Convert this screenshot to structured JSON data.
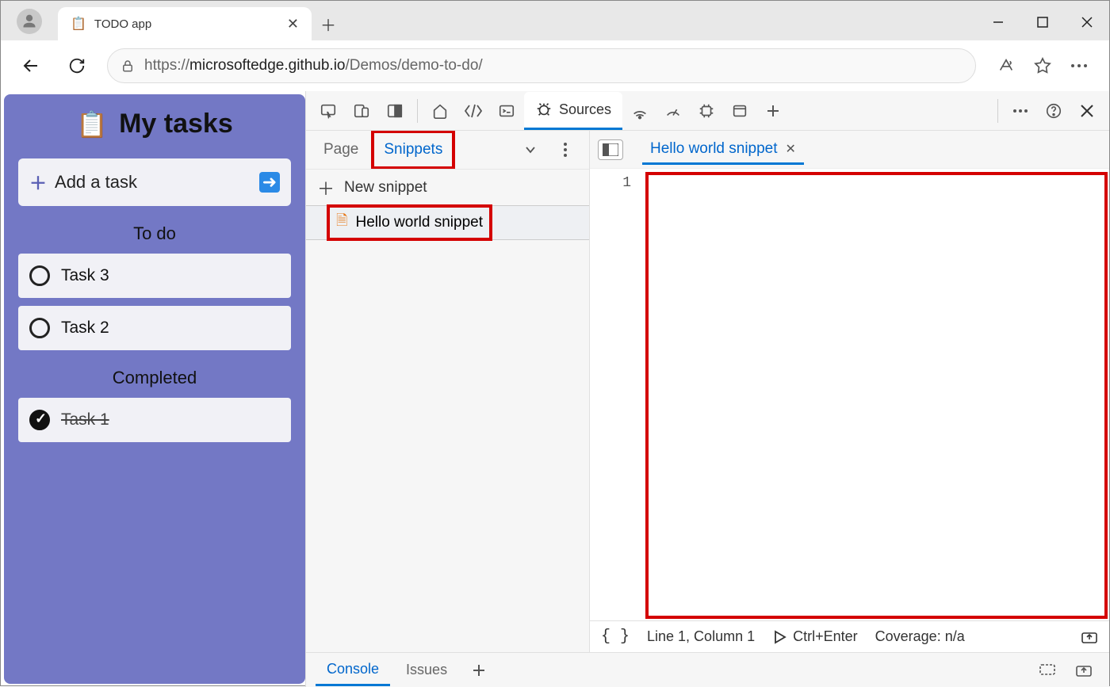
{
  "browser": {
    "tab_title": "TODO app",
    "url": "https://microsoftedge.github.io/Demos/demo-to-do/",
    "url_host": "microsoftedge.github.io",
    "url_prefix": "https://",
    "url_path": "/Demos/demo-to-do/"
  },
  "webpage": {
    "title": "My tasks",
    "add_task_label": "Add a task",
    "todo_heading": "To do",
    "completed_heading": "Completed",
    "todo": [
      {
        "label": "Task 3"
      },
      {
        "label": "Task 2"
      }
    ],
    "completed": [
      {
        "label": "Task 1"
      }
    ]
  },
  "devtools": {
    "active_panel": "Sources",
    "nav_tabs": {
      "page": "Page",
      "snippets": "Snippets"
    },
    "new_snippet_label": "New snippet",
    "snippets": [
      {
        "name": "Hello world snippet"
      }
    ],
    "editor": {
      "open_tab": "Hello world snippet",
      "line_numbers": [
        "1"
      ],
      "status_pos": "Line 1, Column 1",
      "run_shortcut": "Ctrl+Enter",
      "coverage": "Coverage: n/a"
    },
    "console_tabs": {
      "console": "Console",
      "issues": "Issues"
    }
  }
}
